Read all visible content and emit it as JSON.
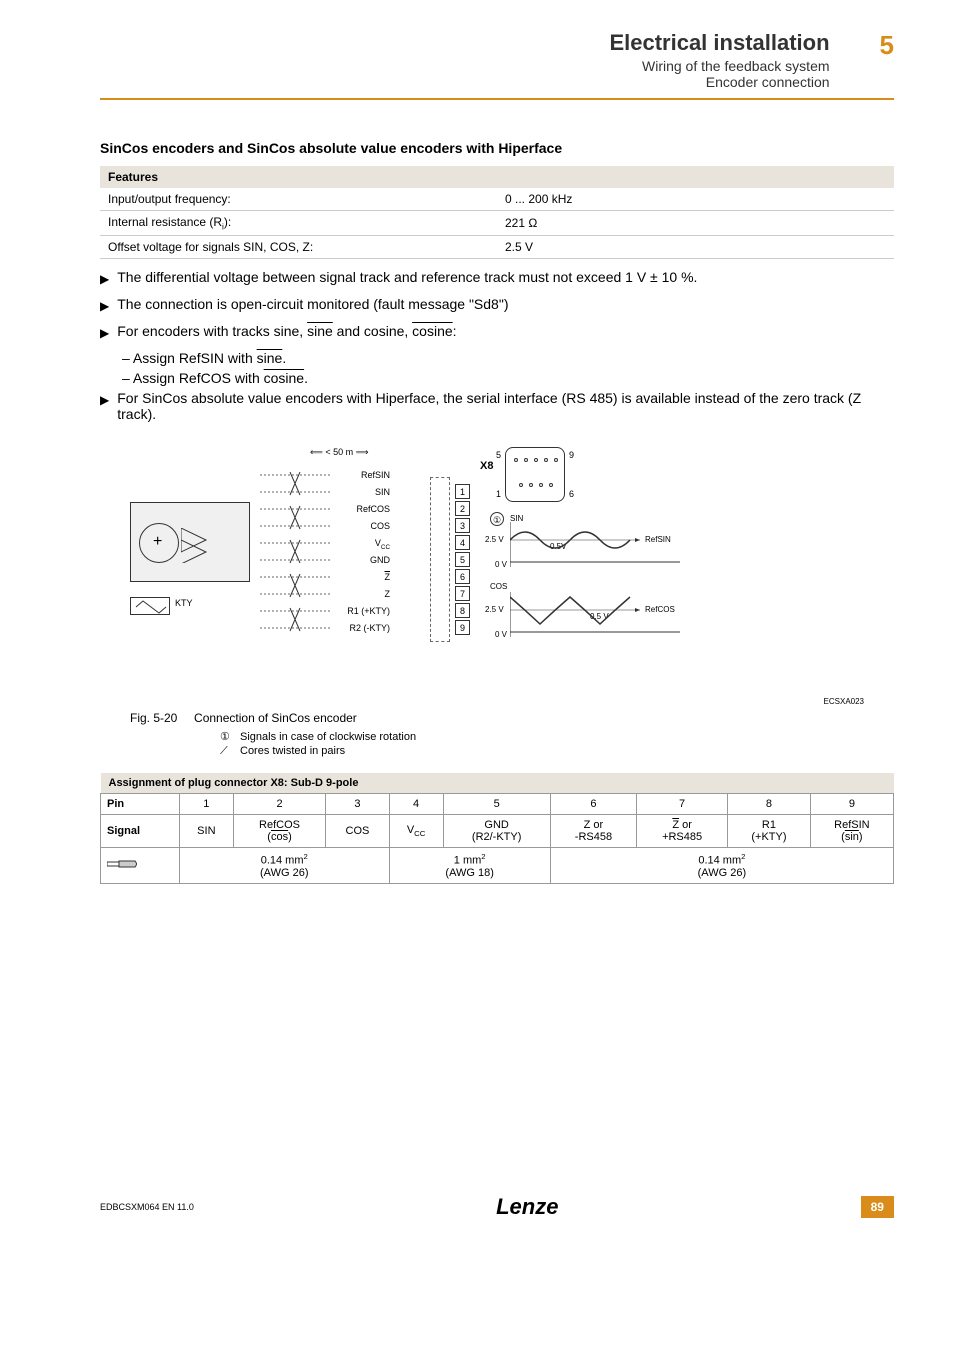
{
  "header": {
    "title": "Electrical installation",
    "sub1": "Wiring of the feedback system",
    "sub2": "Encoder connection",
    "chapter": "5"
  },
  "section_title": "SinCos encoders and SinCos absolute value encoders with Hiperface",
  "features": {
    "header": "Features",
    "rows": [
      {
        "label": "Input/output frequency:",
        "value": "0 ... 200 kHz"
      },
      {
        "label_html": "Internal resistance (R<sub>i</sub>):",
        "value": "221 Ω"
      },
      {
        "label": "Offset voltage for signals SIN, COS, Z:",
        "value": "2.5 V"
      }
    ]
  },
  "bullets": {
    "b1": "The differential voltage between signal track and reference track must not exceed 1 V ± 10 %.",
    "b2": "The connection is open-circuit monitored (fault message \"Sd8\")",
    "b3_pre": "For encoders with tracks sine, ",
    "b3_ov1": "sine",
    "b3_mid": " and cosine, ",
    "b3_ov2": "cosine",
    "b3_post": ":",
    "b3s1_pre": "– Assign RefSIN with ",
    "b3s1_ov": "sine",
    "b3s1_post": ".",
    "b3s2_pre": "– Assign RefCOS with ",
    "b3s2_ov": "cosine",
    "b3s2_post": ".",
    "b4": "For SinCos absolute value encoders with Hiperface, the serial interface (RS 485) is available instead of the zero track (Z track)."
  },
  "diagram": {
    "cable_len": "< 50 m",
    "x8": "X8",
    "kty": "KTY",
    "signals": [
      "RefSIN",
      "SIN",
      "RefCOS",
      "COS",
      "V",
      "GND",
      "Z",
      "Z",
      "R1 (+KTY)",
      "R2 (-KTY)"
    ],
    "vcc_sub": "CC",
    "pins": [
      "1",
      "2",
      "3",
      "4",
      "5",
      "6",
      "7",
      "8",
      "9"
    ],
    "conn_nums": {
      "tl": "5",
      "tr": "9",
      "bl": "1",
      "br": "6"
    },
    "wave_num": "①",
    "wave": {
      "sin": "SIN",
      "cos": "COS",
      "refsin": "RefSIN",
      "refcos": "RefCOS",
      "v25": "2.5 V",
      "v0": "0 V",
      "v05": "0.5V",
      "v05s": "0.5 V"
    },
    "code": "ECSXA023"
  },
  "figure": {
    "num": "Fig. 5-20",
    "caption": "Connection of SinCos encoder",
    "legend1_sym": "①",
    "legend1": "Signals in case of clockwise rotation",
    "legend2_sym": "⟋",
    "legend2": "Cores twisted in pairs"
  },
  "pin_table": {
    "header": "Assignment of plug connector X8: Sub-D 9-pole",
    "pin_label": "Pin",
    "signal_label": "Signal",
    "pins": [
      "1",
      "2",
      "3",
      "4",
      "5",
      "6",
      "7",
      "8",
      "9"
    ],
    "signals": {
      "s1": "SIN",
      "s2a": "RefCOS",
      "s2b_ov": "cos",
      "s3": "COS",
      "s4_html": "V<sub>CC</sub>",
      "s5a": "GND",
      "s5b": "(R2/-KTY)",
      "s6a": "Z or",
      "s6b": "-RS458",
      "s7a_pre": "",
      "s7a_ov": "Z",
      "s7a_post": " or",
      "s7b": "+RS485",
      "s8a": "R1",
      "s8b": "(+KTY)",
      "s9a": "RefSIN",
      "s9b_ov": "sin"
    },
    "wire": {
      "w1a": "0.14 mm",
      "w1b": "(AWG 26)",
      "w2a": "1 mm",
      "w2b": "(AWG 18)",
      "w3a": "0.14 mm",
      "w3b": "(AWG 26)",
      "sup2": "2"
    }
  },
  "footer": {
    "left": "EDBCSXM064 EN 11.0",
    "logo": "Lenze",
    "page": "89"
  }
}
